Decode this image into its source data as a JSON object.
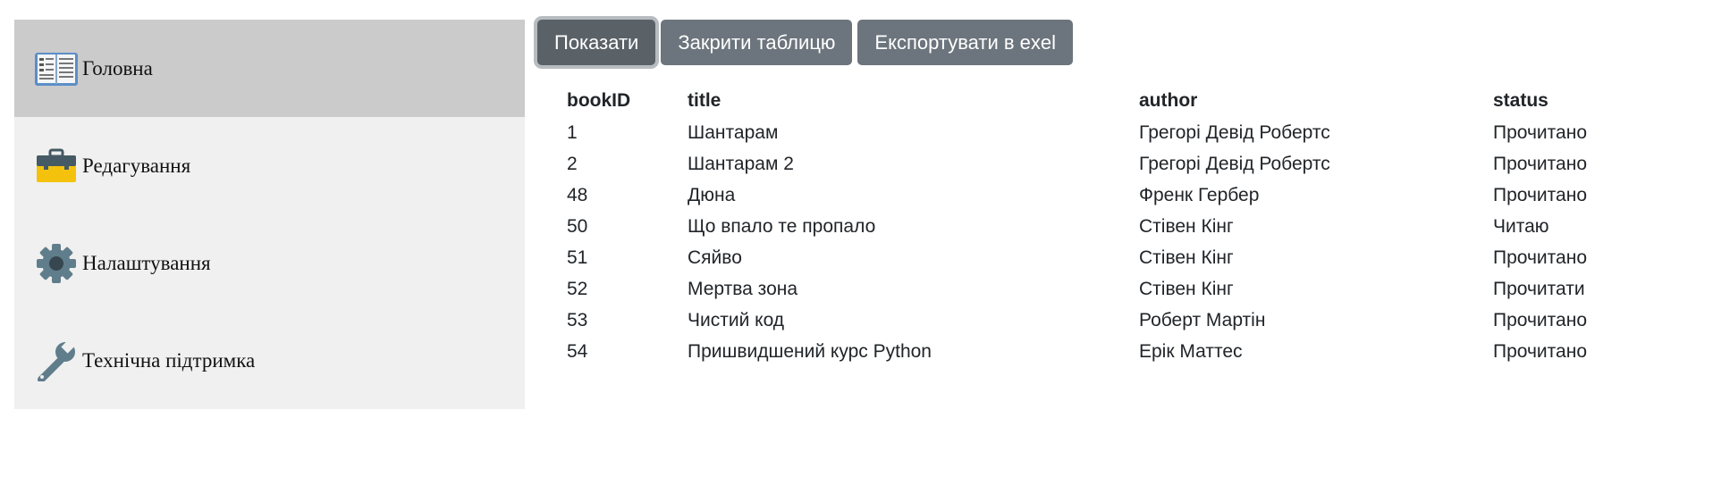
{
  "sidebar": {
    "items": [
      {
        "label": "Головна",
        "icon": "book-icon",
        "active": true
      },
      {
        "label": "Редагування",
        "icon": "toolbox-icon",
        "active": false
      },
      {
        "label": "Налаштування",
        "icon": "gear-icon",
        "active": false
      },
      {
        "label": "Технічна підтримка",
        "icon": "wrench-icon",
        "active": false
      }
    ]
  },
  "toolbar": {
    "show_label": "Показати",
    "close_label": "Закрити таблицю",
    "export_label": "Експортувати в exel"
  },
  "table": {
    "columns": [
      "bookID",
      "title",
      "author",
      "status"
    ],
    "rows": [
      [
        "1",
        "Шантарам",
        "Грегорі Девід Робертс",
        "Прочитано"
      ],
      [
        "2",
        "Шантарам 2",
        "Грегорі Девід Робертс",
        "Прочитано"
      ],
      [
        "48",
        "Дюна",
        "Френк Гербер",
        "Прочитано"
      ],
      [
        "50",
        "Що впало те пропало",
        "Стівен Кінг",
        "Читаю"
      ],
      [
        "51",
        "Сяйво",
        "Стівен Кінг",
        "Прочитано"
      ],
      [
        "52",
        "Мертва зона",
        "Стівен Кінг",
        "Прочитати"
      ],
      [
        "53",
        "Чистий код",
        "Роберт Мартін",
        "Прочитано"
      ],
      [
        "54",
        "Пришвидшений курс Python",
        "Ерік Маттес",
        "Прочитано"
      ]
    ]
  },
  "colors": {
    "button": "#6c757d",
    "sidebar_bg": "#f0f0f0",
    "sidebar_active": "#cbcbcb"
  }
}
